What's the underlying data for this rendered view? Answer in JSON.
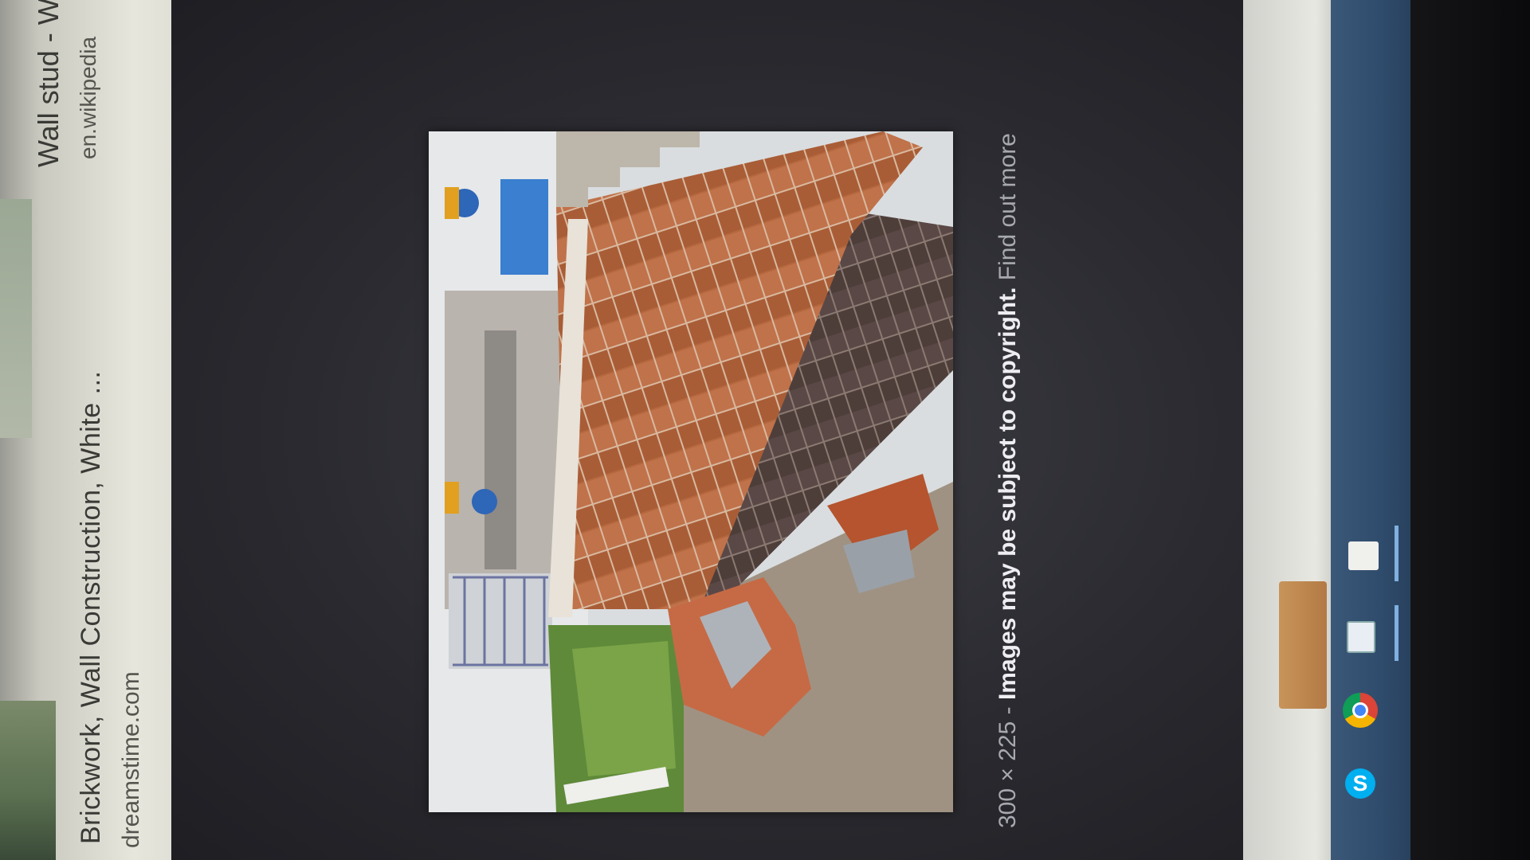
{
  "left_results": {
    "title": "Brickwork, Wall Construction, White ...",
    "source": "dreamstime.com",
    "title2": "Wall stud - W",
    "source2": "en.wikipedia"
  },
  "preview": {
    "dimensions": "300 × 225",
    "separator": " - ",
    "copyright_text": "Images may be subject to copyright.",
    "find_more": "Find out more"
  },
  "taskbar": {
    "icons": [
      "film-icon",
      "notepad-icon",
      "chrome-icon",
      "skype-icon"
    ],
    "skype_glyph": "S"
  },
  "colors": {
    "panel": "#2a2a30",
    "taskbar": "#2f4b6b",
    "brick": "#b8653a"
  }
}
